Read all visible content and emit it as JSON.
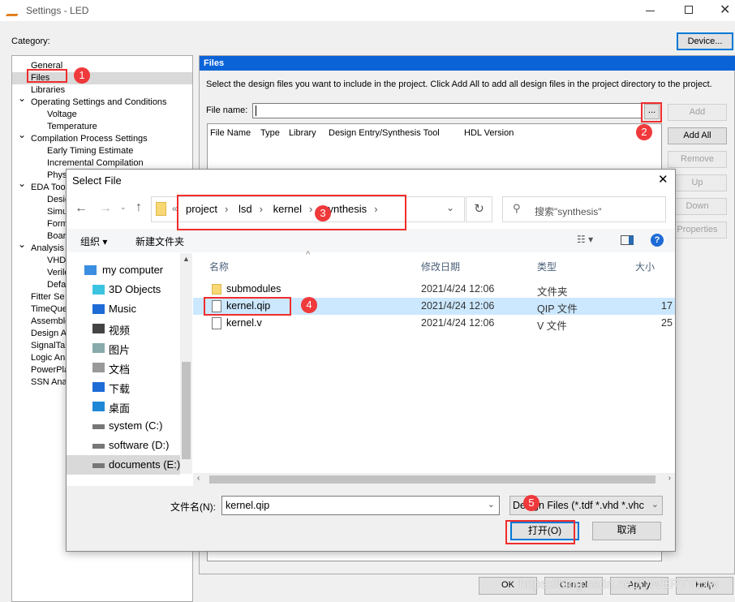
{
  "window": {
    "title": "Settings - LED",
    "category_label": "Category:",
    "device_button": "Device..."
  },
  "tree": [
    {
      "label": "General",
      "level": 0
    },
    {
      "label": "Files",
      "level": 0,
      "selected": true
    },
    {
      "label": "Libraries",
      "level": 0
    },
    {
      "label": "Operating Settings and Conditions",
      "level": 0,
      "expanded": true
    },
    {
      "label": "Voltage",
      "level": 1
    },
    {
      "label": "Temperature",
      "level": 1
    },
    {
      "label": "Compilation Process Settings",
      "level": 0,
      "expanded": true
    },
    {
      "label": "Early Timing Estimate",
      "level": 1
    },
    {
      "label": "Incremental Compilation",
      "level": 1
    },
    {
      "label": "Phys",
      "level": 1
    },
    {
      "label": "EDA Tool",
      "level": 0,
      "expanded": true
    },
    {
      "label": "Desig",
      "level": 1
    },
    {
      "label": "Simu",
      "level": 1
    },
    {
      "label": "Form",
      "level": 1
    },
    {
      "label": "Boar",
      "level": 1
    },
    {
      "label": "Analysis",
      "level": 0,
      "expanded": true
    },
    {
      "label": "VHDL",
      "level": 1
    },
    {
      "label": "Verilo",
      "level": 1
    },
    {
      "label": "Defa",
      "level": 1
    },
    {
      "label": "Fitter Se",
      "level": 0
    },
    {
      "label": "TimeQue",
      "level": 0
    },
    {
      "label": "Assemble",
      "level": 0
    },
    {
      "label": "Design A",
      "level": 0
    },
    {
      "label": "SignalTap",
      "level": 0
    },
    {
      "label": "Logic Ana",
      "level": 0
    },
    {
      "label": "PowerPla",
      "level": 0
    },
    {
      "label": "SSN Anal",
      "level": 0
    }
  ],
  "files_panel": {
    "header": "Files",
    "description": "Select the design files you want to include in the project. Click Add All to add all design files in the project directory to the project.",
    "file_name_label": "File name:",
    "file_name_value": "",
    "browse_label": "...",
    "columns": [
      "File Name",
      "Type",
      "Library",
      "Design Entry/Synthesis Tool",
      "HDL Version"
    ],
    "buttons": {
      "add": "Add",
      "add_all": "Add All",
      "remove": "Remove",
      "up": "Up",
      "down": "Down",
      "properties": "Properties"
    }
  },
  "footer": {
    "ok": "OK",
    "cancel": "Cancel",
    "apply": "Apply",
    "help": "Help",
    "watermark": "https://blog.csdn.net/QWERTYzxw"
  },
  "dialog": {
    "title": "Select File",
    "path": [
      "project",
      "lsd",
      "kernel",
      "synthesis"
    ],
    "search_placeholder": "搜索\"synthesis\"",
    "organize": "组织 ▾",
    "new_folder": "新建文件夹",
    "nav": [
      "my computer",
      "3D Objects",
      "Music",
      "视频",
      "图片",
      "文档",
      "下载",
      "桌面",
      "system (C:)",
      "software (D:)",
      "documents (E:)"
    ],
    "columns": [
      "名称",
      "修改日期",
      "类型",
      "大小"
    ],
    "files": [
      {
        "name": "submodules",
        "date": "2021/4/24 12:06",
        "type": "文件夹",
        "size": "",
        "icon": "folder-icon"
      },
      {
        "name": "kernel.qip",
        "date": "2021/4/24 12:06",
        "type": "QIP 文件",
        "size": "17",
        "icon": "file-icon",
        "selected": true
      },
      {
        "name": "kernel.v",
        "date": "2021/4/24 12:06",
        "type": "V 文件",
        "size": "25",
        "icon": "file-icon"
      }
    ],
    "filename_label": "文件名(N):",
    "filename_value": "kernel.qip",
    "filter": "Design Files (*.tdf *.vhd *.vhc",
    "open": "打开(O)",
    "cancel": "取消"
  },
  "annotations": [
    "1",
    "2",
    "3",
    "4",
    "5"
  ],
  "colors": {
    "accent": "#0078d7",
    "header_blue": "#0a64d8",
    "selection": "#cce8ff",
    "annotation_red": "#f02d2d"
  }
}
